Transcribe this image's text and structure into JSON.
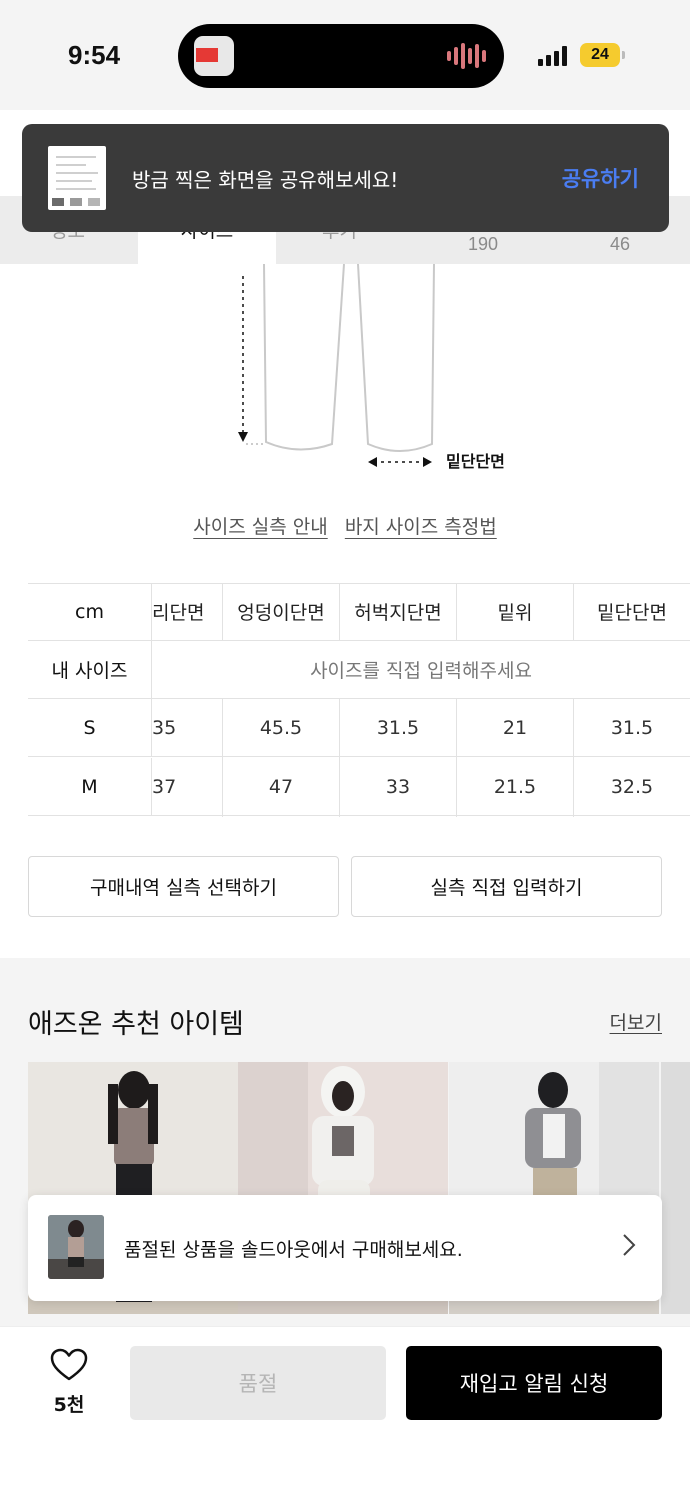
{
  "status_bar": {
    "time": "9:54",
    "battery": "24"
  },
  "screenshot_toast": {
    "message": "방금 찍은 화면을 공유해보세요!",
    "action": "공유하기"
  },
  "tab_strip": {
    "active_tab": "사이즈",
    "numbers": [
      "190",
      "46"
    ]
  },
  "diagram": {
    "hem_label": "밑단단면"
  },
  "guide_links": {
    "size_guide": "사이즈 실측 안내",
    "measure_guide": "바지 사이즈 측정법"
  },
  "size_table": {
    "unit": "cm",
    "columns": [
      "리단면",
      "엉덩이단면",
      "허벅지단면",
      "밑위",
      "밑단단면"
    ],
    "my_size_label": "내 사이즈",
    "my_size_placeholder": "사이즈를 직접 입력해주세요",
    "rows": [
      {
        "size": "S",
        "values": [
          "35",
          "45.5",
          "31.5",
          "21",
          "31.5"
        ]
      },
      {
        "size": "M",
        "values": [
          "37",
          "47",
          "33",
          "21.5",
          "32.5"
        ]
      }
    ]
  },
  "actions": {
    "select_purchase": "구매내역 실측 선택하기",
    "direct_input": "실측 직접 입력하기"
  },
  "recommendations": {
    "title": "애즈온 추천 아이템",
    "more": "더보기"
  },
  "soldout_banner": {
    "text": "품절된 상품을 솔드아웃에서 구매해보세요."
  },
  "bottom_bar": {
    "like_count": "5천",
    "soldout_button": "품절",
    "restock_button": "재입고 알림 신청"
  },
  "colors": {
    "share_accent": "#4a7df2",
    "battery": "#f5cb2e",
    "primary_button": "#000000",
    "disabled_button": "#e9e9e9"
  }
}
